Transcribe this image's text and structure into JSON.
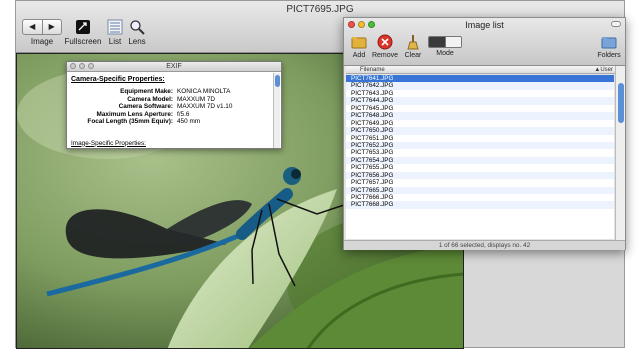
{
  "viewer": {
    "title": "PICT7695.JPG",
    "toolbar": {
      "image": "Image",
      "fullscreen": "Fullscreen",
      "list": "List",
      "lens": "Lens",
      "prev": "◀",
      "next": "▶"
    }
  },
  "exif": {
    "title": "EXIF",
    "section_camera": "Camera-Specific Properties:",
    "rows": [
      {
        "key": "Equipment Make:",
        "value": "KONICA MINOLTA"
      },
      {
        "key": "Camera Model:",
        "value": "MAXXUM 7D"
      },
      {
        "key": "Camera Software:",
        "value": "MAXXUM 7D v1.10"
      },
      {
        "key": "Maximum Lens Aperture:",
        "value": "f/5.6"
      },
      {
        "key": "Focal Length (35mm Equiv):",
        "value": "450 mm"
      }
    ],
    "section_image": "Image-Specific Properties:"
  },
  "image_list": {
    "title": "Image list",
    "toolbar": {
      "add": "Add",
      "remove": "Remove",
      "clear": "Clear",
      "mode": "Mode",
      "folders": "Folders"
    },
    "column_filename": "Filename",
    "column_user": "User",
    "files": [
      "PICT7641.JPG",
      "PICT7642.JPG",
      "PICT7643.JPG",
      "PICT7644.JPG",
      "PICT7645.JPG",
      "PICT7648.JPG",
      "PICT7649.JPG",
      "PICT7650.JPG",
      "PICT7651.JPG",
      "PICT7652.JPG",
      "PICT7653.JPG",
      "PICT7654.JPG",
      "PICT7655.JPG",
      "PICT7656.JPG",
      "PICT7657.JPG",
      "PICT7665.JPG",
      "PICT7666.JPG",
      "PICT7668.JPG"
    ],
    "status": "1 of 66 selected, displays no. 42"
  },
  "colors": {
    "selection": "#3875d7",
    "traffic_red": "#f0524a",
    "traffic_yellow": "#f5c02f",
    "traffic_green": "#4bc13a"
  }
}
